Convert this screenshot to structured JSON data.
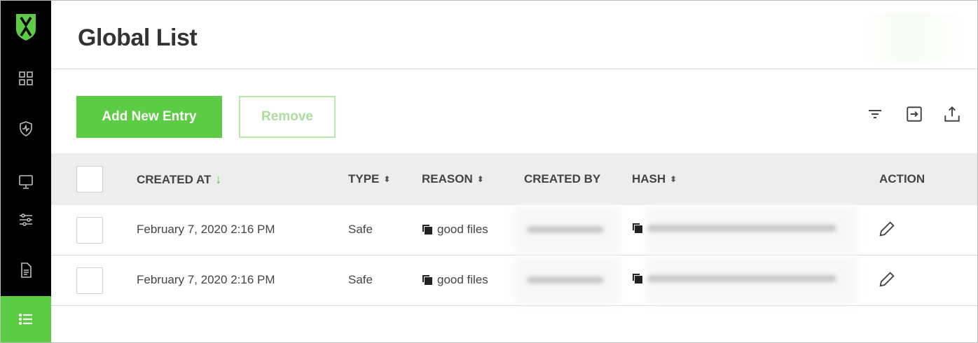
{
  "colors": {
    "accent": "#5ccc44",
    "sidebar_bg": "#000000",
    "header_row_bg": "#ededed"
  },
  "sidebar": {
    "logo_icon": "shield-logo-icon",
    "items": [
      {
        "icon": "dashboard-grid-icon",
        "active": false
      },
      {
        "icon": "shield-alert-icon",
        "active": false
      },
      {
        "icon": "monitor-icon",
        "active": false
      },
      {
        "icon": "sliders-icon",
        "active": false
      },
      {
        "icon": "document-icon",
        "active": false
      },
      {
        "icon": "list-icon",
        "active": true
      }
    ]
  },
  "header": {
    "title": "Global List"
  },
  "toolbar": {
    "add_label": "Add New Entry",
    "remove_label": "Remove",
    "icons": [
      "filter-icon",
      "import-icon",
      "export-icon"
    ]
  },
  "table": {
    "columns": {
      "created_at": "CREATED AT",
      "type": "TYPE",
      "reason": "REASON",
      "created_by": "CREATED BY",
      "hash": "HASH",
      "action": "ACTION"
    },
    "rows": [
      {
        "created_at": "February 7, 2020 2:16 PM",
        "type": "Safe",
        "reason": "good files"
      },
      {
        "created_at": "February 7, 2020 2:16 PM",
        "type": "Safe",
        "reason": "good files"
      }
    ]
  }
}
